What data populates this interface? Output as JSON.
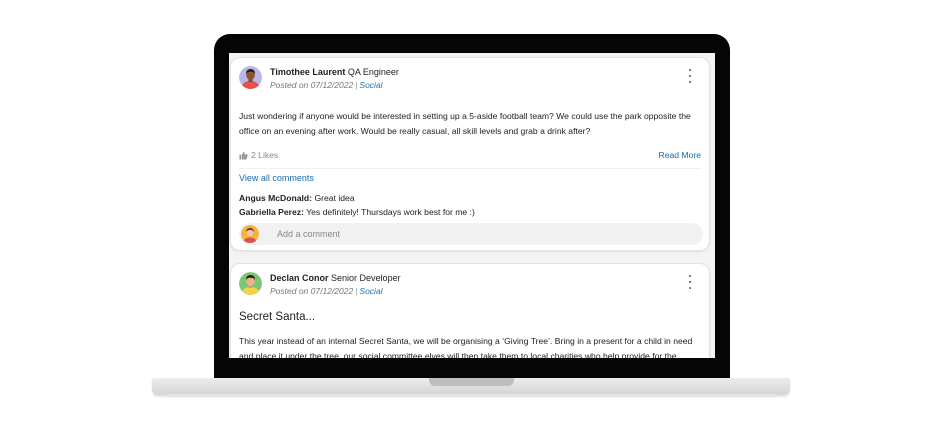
{
  "posts": [
    {
      "author_name": "Timothee Laurent",
      "author_role": "QA Engineer",
      "posted_label": "Posted on 07/12/2022",
      "separator": "|",
      "category": "Social",
      "body": "Just wondering if anyone would be interested in setting up a 5-aside football team? We could use the park opposite the office on an evening after work. Would be really casual, all skill levels and grab a drink after?",
      "likes": "2 Likes",
      "read_more": "Read More",
      "view_all_comments": "View all comments",
      "comments": [
        {
          "name": "Angus McDonald:",
          "text": "Great idea"
        },
        {
          "name": "Gabriella Perez:",
          "text": "Yes definitely! Thursdays work best for me :)"
        }
      ],
      "add_comment_placeholder": "Add a comment"
    },
    {
      "author_name": "Declan Conor",
      "author_role": "Senior Developer",
      "posted_label": "Posted on 07/12/2022",
      "separator": "|",
      "category": "Social",
      "title": "Secret Santa...",
      "body": "This year instead of an internal Secret Santa, we will be organising a ‘Giving Tree’. Bring in a present for a child in need and place it under the tree, our social committee elves will then take them to local charities who help provide for the"
    }
  ],
  "icons": {
    "like": "thumbs-up-icon",
    "menu": "more-vertical-icon"
  },
  "colors": {
    "link": "#1a6aa8",
    "category": "#1a76b8",
    "laptop_bezel": "#050505"
  }
}
